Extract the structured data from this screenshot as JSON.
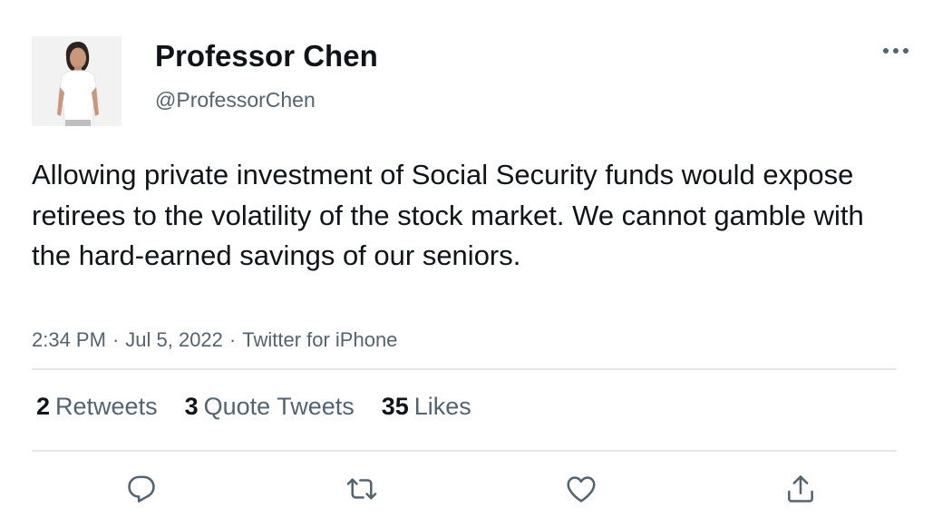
{
  "author": {
    "display_name": "Professor Chen",
    "handle": "@ProfessorChen"
  },
  "tweet": {
    "text": "Allowing private investment of Social Security funds would expose retirees to the volatility of the stock market. We cannot gamble with the hard-earned savings of our seniors.",
    "time": "2:34 PM",
    "date": "Jul 5, 2022",
    "source": "Twitter for iPhone",
    "separator": "·"
  },
  "stats": {
    "retweets": {
      "count": "2",
      "label": "Retweets"
    },
    "quote_tweets": {
      "count": "3",
      "label": "Quote Tweets"
    },
    "likes": {
      "count": "35",
      "label": "Likes"
    }
  },
  "actions": {
    "reply_icon": "reply-icon",
    "retweet_icon": "retweet-icon",
    "like_icon": "heart-icon",
    "share_icon": "share-icon"
  },
  "colors": {
    "text_primary": "#0f1419",
    "text_secondary": "#536471",
    "divider": "#e4e7ea"
  }
}
